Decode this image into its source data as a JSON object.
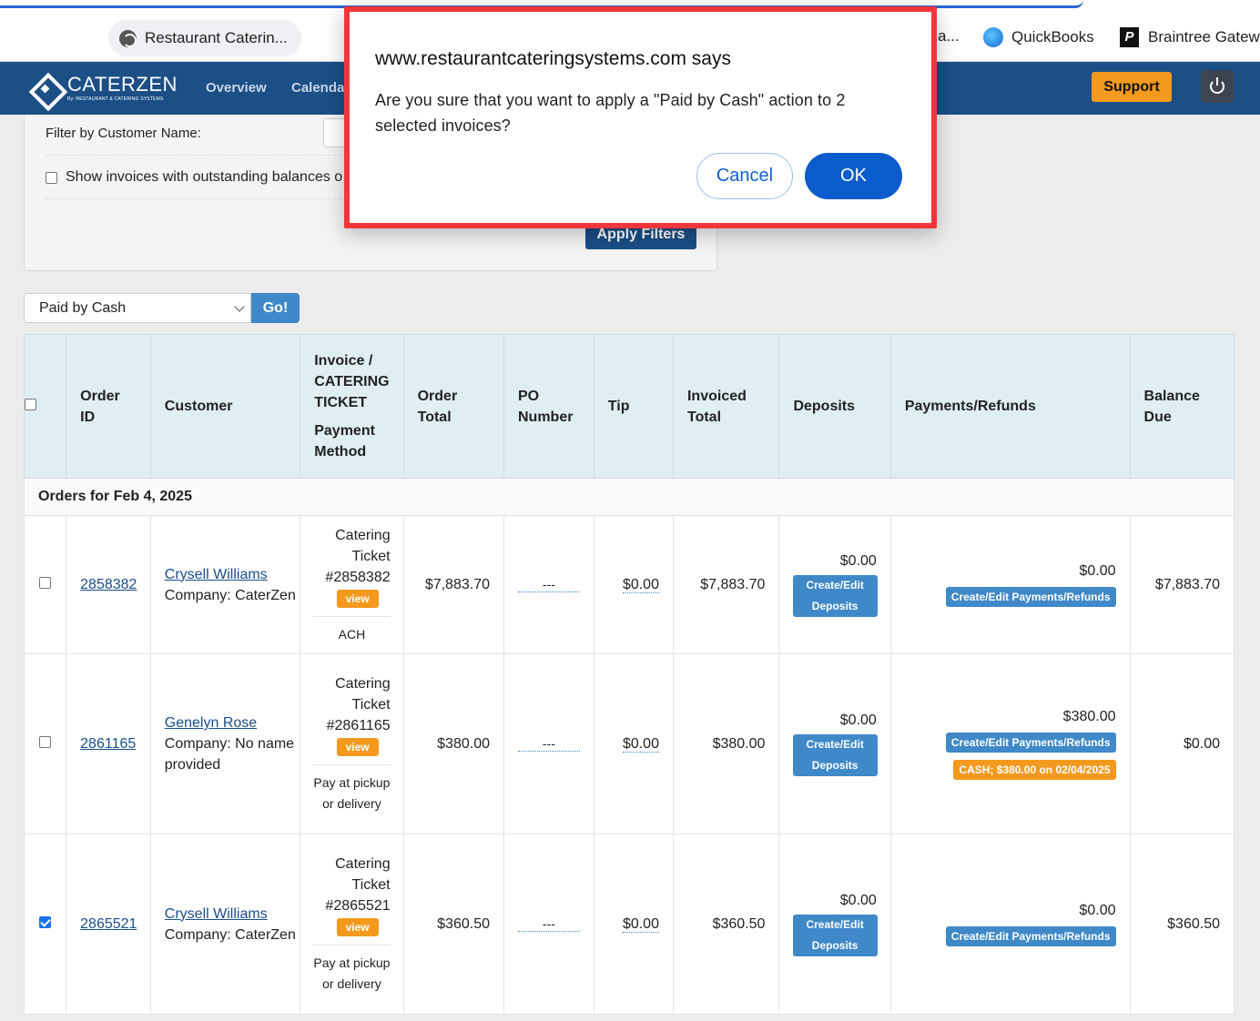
{
  "browser": {
    "tab_title": "Restaurant Caterin...",
    "bookmark_partial": "a...",
    "bookmarks": [
      "QuickBooks",
      "Braintree Gatew"
    ]
  },
  "app": {
    "logo_name": "CATERZEN",
    "logo_sub": "By: RESTAURANT & CATERING SYSTEMS",
    "nav": [
      "Overview",
      "Calenda"
    ],
    "support_label": "Support"
  },
  "filters": {
    "customer_name_label": "Filter by Customer Name:",
    "outstanding_label": "Show invoices with outstanding balances o",
    "apply_label": "Apply Filters"
  },
  "bulk_action": {
    "selected": "Paid by Cash",
    "go_label": "Go!"
  },
  "table": {
    "headers": {
      "order_id": "Order ID",
      "customer": "Customer",
      "invoice": "Invoice / CATERING TICKET",
      "payment_method": "Payment Method",
      "order_total": "Order Total",
      "po_number": "PO Number",
      "tip": "Tip",
      "invoiced_total": "Invoiced Total",
      "deposits": "Deposits",
      "payments": "Payments/Refunds",
      "balance_due": "Balance Due"
    },
    "group_label": "Orders for Feb 4, 2025",
    "view_label": "view",
    "deposit_btn": "Create/Edit Deposits",
    "payment_btn": "Create/Edit Payments/Refunds",
    "rows": [
      {
        "order_id": "2858382",
        "customer_name": "Crysell Williams",
        "company": "Company: CaterZen",
        "ticket_type": "Catering Ticket",
        "ticket_no": "#2858382",
        "payment_method": "ACH",
        "order_total": "$7,883.70",
        "po": "---",
        "tip": "$0.00",
        "invoiced_total": "$7,883.70",
        "deposit_amt": "$0.00",
        "payment_amt": "$0.00",
        "cash_note": "",
        "balance": "$7,883.70",
        "checked": false
      },
      {
        "order_id": "2861165",
        "customer_name": "Genelyn Rose",
        "company": "Company: No name provided",
        "ticket_type": "Catering Ticket",
        "ticket_no": "#2861165",
        "payment_method": "Pay at pickup or delivery",
        "order_total": "$380.00",
        "po": "---",
        "tip": "$0.00",
        "invoiced_total": "$380.00",
        "deposit_amt": "$0.00",
        "payment_amt": "$380.00",
        "cash_note": "CASH; $380.00 on 02/04/2025",
        "balance": "$0.00",
        "checked": false
      },
      {
        "order_id": "2865521",
        "customer_name": "Crysell Williams",
        "company": "Company: CaterZen",
        "ticket_type": "Catering Ticket",
        "ticket_no": "#2865521",
        "payment_method": "Pay at pickup or delivery",
        "order_total": "$360.50",
        "po": "---",
        "tip": "$0.00",
        "invoiced_total": "$360.50",
        "deposit_amt": "$0.00",
        "payment_amt": "$0.00",
        "cash_note": "",
        "balance": "$360.50",
        "checked": true
      }
    ]
  },
  "dialog": {
    "title": "www.restaurantcateringsystems.com says",
    "message": "Are you sure that you want to apply a \"Paid by Cash\" action to 2 selected invoices?",
    "cancel_label": "Cancel",
    "ok_label": "OK"
  }
}
